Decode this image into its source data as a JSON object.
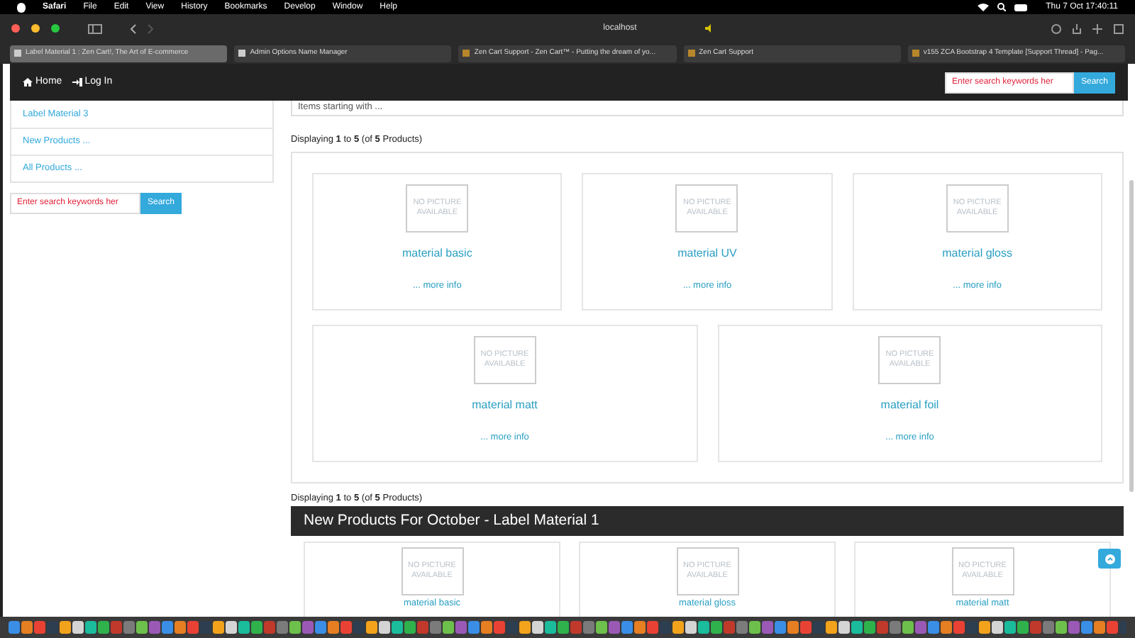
{
  "menu_bar": {
    "app": "Safari",
    "items": [
      "File",
      "Edit",
      "View",
      "History",
      "Bookmarks",
      "Develop",
      "Window",
      "Help"
    ],
    "clock": "Thu 7 Oct  17:40:11"
  },
  "address_bar": {
    "url": "localhost"
  },
  "tabs": [
    {
      "label": "Label Material 1 : Zen Cart!, The Art of E-commerce",
      "selected": true
    },
    {
      "label": "Admin Options Name Manager",
      "selected": false
    },
    {
      "label": "Zen Cart Support - Zen Cart™ - Putting the dream of yo...",
      "selected": false
    },
    {
      "label": "Zen Cart Support",
      "selected": false
    },
    {
      "label": "v155 ZCA Bootstrap 4 Template [Support Thread] - Pag...",
      "selected": false
    }
  ],
  "navbar": {
    "links": [
      "Home",
      "Log In"
    ],
    "search": {
      "placeholder": "Enter search keywords her",
      "button": "Search"
    }
  },
  "sidebar": {
    "links": [
      "Label Material 3",
      "New Products ...",
      "All Products ..."
    ],
    "search": {
      "placeholder": "Enter search keywords her",
      "button": "Search"
    }
  },
  "filter": {
    "value": "Items starting with ..."
  },
  "listing": {
    "count_text": "Displaying **1** to **5** (of **5** Products)",
    "products": [
      {
        "name": "material basic",
        "image_text": "NO PICTURE AVAILABLE",
        "more": "... more info"
      },
      {
        "name": "material UV",
        "image_text": "NO PICTURE AVAILABLE",
        "more": "... more info"
      },
      {
        "name": "material gloss",
        "image_text": "NO PICTURE AVAILABLE",
        "more": "... more info"
      },
      {
        "name": "material matt",
        "image_text": "NO PICTURE AVAILABLE",
        "more": "... more info"
      },
      {
        "name": "material foil",
        "image_text": "NO PICTURE AVAILABLE",
        "more": "... more info"
      }
    ]
  },
  "bottom_count_text": "Displaying **1** to **5** (of **5** Products)",
  "new_products": {
    "title": "New Products For October - Label Material 1",
    "products": [
      {
        "name": "material basic",
        "image_text": "NO PICTURE AVAILABLE"
      },
      {
        "name": "material gloss",
        "image_text": "NO PICTURE AVAILABLE"
      },
      {
        "name": "material matt",
        "image_text": "NO PICTURE AVAILABLE"
      }
    ]
  }
}
